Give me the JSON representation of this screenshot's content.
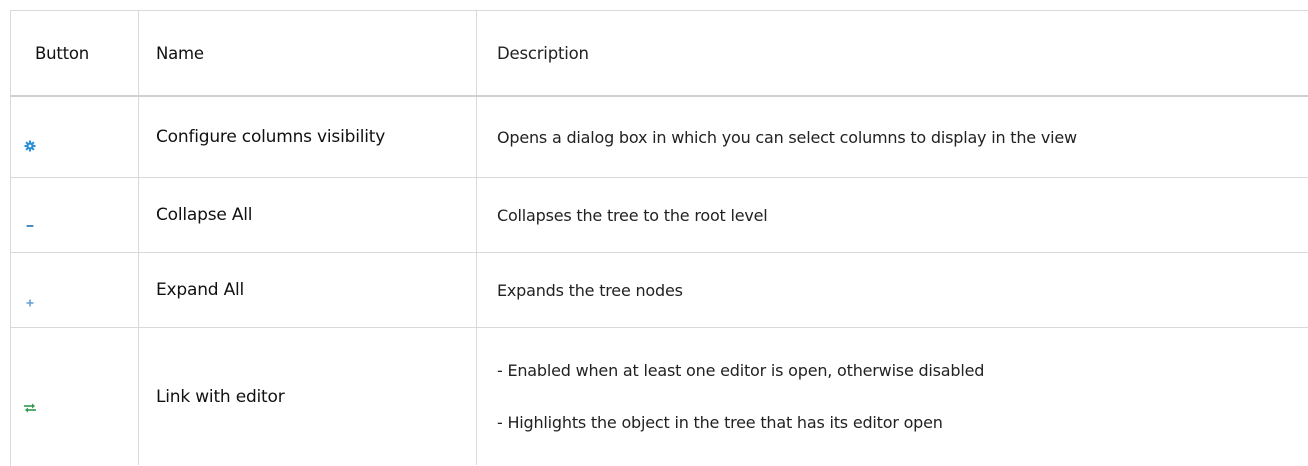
{
  "table": {
    "headers": [
      "Button",
      "Name",
      "Description"
    ],
    "rows": [
      {
        "icon": "gear-icon",
        "name": "Configure columns visibility",
        "description": [
          "Opens a dialog box in which you can select columns to display in the view"
        ]
      },
      {
        "icon": "collapse-all-icon",
        "name": "Collapse All",
        "description": [
          "Collapses the tree to the root level"
        ]
      },
      {
        "icon": "expand-all-icon",
        "name": "Expand All",
        "description": [
          "Expands the tree nodes"
        ]
      },
      {
        "icon": "link-with-editor-icon",
        "name": "Link with editor",
        "description": [
          "- Enabled when at least one editor is open, otherwise disabled",
          "- Highlights the object in the tree that has its editor open"
        ]
      }
    ]
  },
  "colors": {
    "gear_icon": "#2a8fd6",
    "collapse_icon": "#4a8cc7",
    "expand_icon": "#6aa3d4",
    "link_icon": "#2e9a4a",
    "border": "#d9d9d9"
  }
}
